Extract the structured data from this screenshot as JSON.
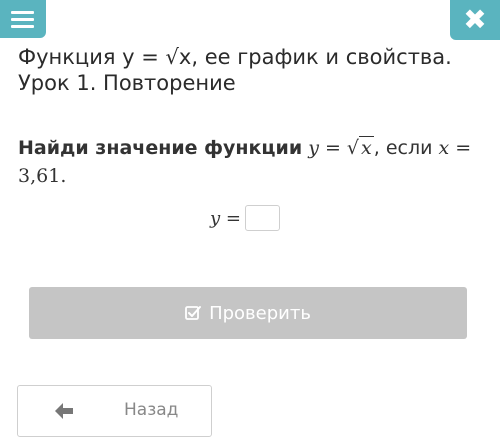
{
  "header": {
    "menu_icon": "hamburger-menu-icon",
    "close_icon": "close-icon",
    "close_glyph": "✖",
    "accent_color": "#5ab4bf"
  },
  "lesson": {
    "title": "Функция y = √x, ее график и свойства. Урок 1. Повторение"
  },
  "task": {
    "prompt": "Найди значение функции",
    "func_y": "y",
    "func_eq": " = ",
    "func_arg": "x",
    "separator": ", ",
    "if_word": "если",
    "var_x": "x",
    "value_eq": "= ",
    "value": "3,61",
    "period": "."
  },
  "answer": {
    "label": "y =",
    "value": ""
  },
  "actions": {
    "check_label": "Проверить",
    "check_icon": "check-square-icon",
    "check_bg": "#c5c5c5",
    "back_label": "Назад",
    "back_icon": "arrow-left-icon"
  }
}
